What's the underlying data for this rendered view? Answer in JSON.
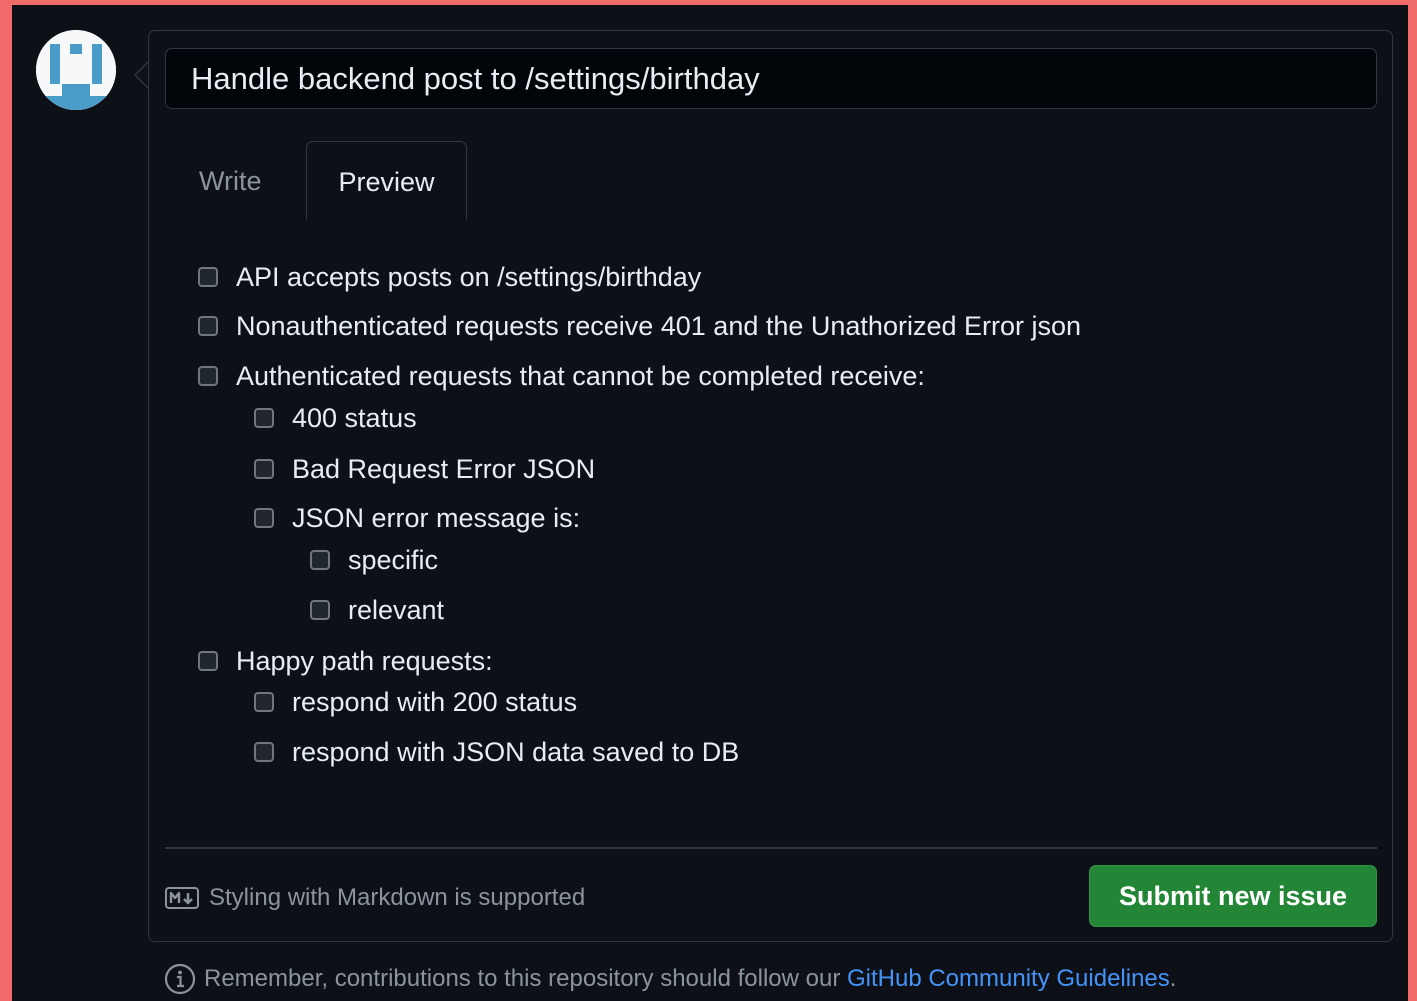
{
  "issue": {
    "title_value": "Handle backend post to /settings/birthday"
  },
  "tabs": {
    "write_label": "Write",
    "preview_label": "Preview",
    "active": "Preview"
  },
  "preview": {
    "tasks": [
      {
        "label": "API accepts posts on /settings/birthday",
        "checked": false,
        "level": 0
      },
      {
        "label": "Nonauthenticated requests receive 401 and the Unathorized Error json",
        "checked": false,
        "level": 0
      },
      {
        "label": "Authenticated requests that cannot be completed receive:",
        "checked": false,
        "level": 0
      },
      {
        "label": "400 status",
        "checked": false,
        "level": 1
      },
      {
        "label": "Bad Request Error JSON",
        "checked": false,
        "level": 1
      },
      {
        "label": "JSON error message is:",
        "checked": false,
        "level": 1
      },
      {
        "label": "specific",
        "checked": false,
        "level": 2
      },
      {
        "label": "relevant",
        "checked": false,
        "level": 2
      },
      {
        "label": "Happy path requests:",
        "checked": false,
        "level": 0
      },
      {
        "label": "respond with 200 status",
        "checked": false,
        "level": 1
      },
      {
        "label": "respond with JSON data saved to DB",
        "checked": false,
        "level": 1
      }
    ]
  },
  "footer": {
    "markdown_note": "Styling with Markdown is supported",
    "submit_label": "Submit new issue",
    "guidelines_prefix": "Remember, contributions to this repository should follow our",
    "guidelines_link": "GitHub Community Guidelines",
    "guidelines_suffix": "."
  },
  "icons": {
    "avatar": "identicon-avatar",
    "markdown": "markdown-icon",
    "info": "info-icon"
  },
  "colors": {
    "background": "#0d1117",
    "border": "#30363d",
    "text": "#e6edf3",
    "muted": "#8b949e",
    "submit_green": "#238636",
    "link_blue": "#4493f8",
    "outer_frame": "#f26b6b"
  }
}
